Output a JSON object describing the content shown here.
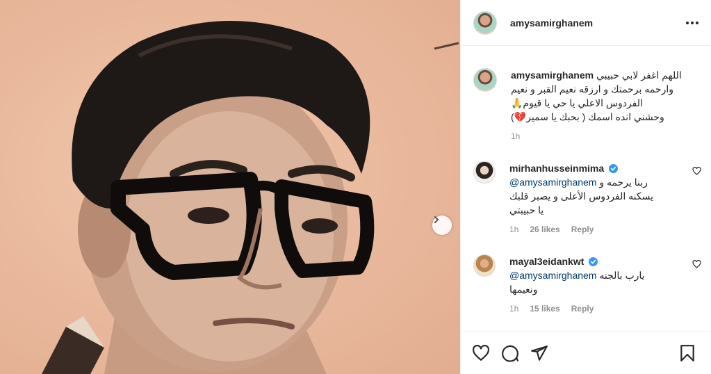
{
  "post": {
    "author": "amysamirghanem",
    "caption_lines": [
      "اللهم اغفر لابي حبيبي",
      "وارحمه برحمتك و ارزقه نعيم القبر و نعيم",
      "الفردوس الاعلي يا حي يا قيوم🙏",
      "وحشني انده اسمك ( بحبك يا سمير💔)"
    ],
    "caption_time": "1h"
  },
  "comments": [
    {
      "username": "mirhanhusseinmima",
      "mention": "@amysamirghanem",
      "text_first": "ربنا يرحمه و",
      "text_rest": [
        "يسكنه الفردوس الأعلى و يصبر قلبك",
        "يا حبيبتي"
      ],
      "time": "1h",
      "likes": "26 likes",
      "reply": "Reply"
    },
    {
      "username": "mayal3eidankwt",
      "mention": "@amysamirghanem",
      "text_first": "يارب بالجنه",
      "text_rest": [
        "ونعيمها"
      ],
      "time": "1h",
      "likes": "15 likes",
      "reply": "Reply"
    }
  ],
  "colors": {
    "accent_verified": "#3897f0",
    "mention": "#00376b",
    "muted": "#8e8e8e",
    "photo_tone": "#e9b89c"
  },
  "icons": [
    "chevron-right-icon",
    "more-icon",
    "verified-icon",
    "heart-icon",
    "comment-icon",
    "share-icon",
    "bookmark-icon"
  ]
}
